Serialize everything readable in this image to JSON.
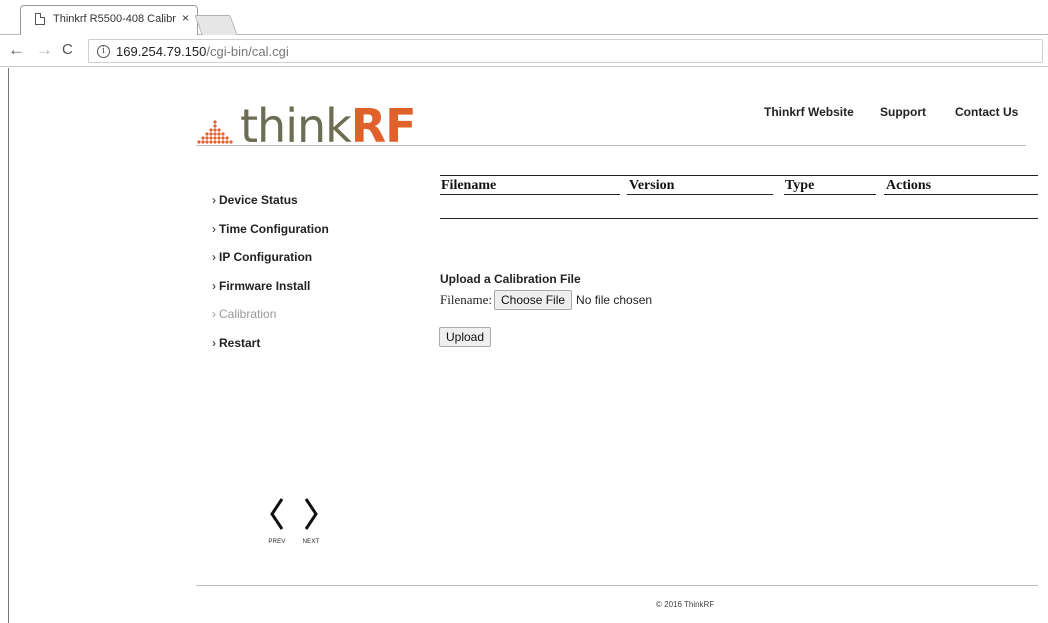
{
  "browser": {
    "tab_title": "Thinkrf R5500-408 Calibr",
    "tab_close": "×",
    "url_host": "169.254.79.150",
    "url_path": "/cgi-bin/cal.cgi",
    "info_glyph": "i",
    "back_glyph": "←",
    "forward_glyph": "→",
    "reload_glyph": "C"
  },
  "logo": {
    "think": "think",
    "rf": "RF"
  },
  "topnav": {
    "website": "Thinkrf Website",
    "support": "Support",
    "contact": "Contact Us"
  },
  "sidebar": {
    "chevron": "›",
    "items": [
      {
        "label": "Device Status"
      },
      {
        "label": "Time Configuration"
      },
      {
        "label": "IP Configuration"
      },
      {
        "label": "Firmware Install"
      },
      {
        "label": "Calibration"
      },
      {
        "label": "Restart"
      }
    ]
  },
  "table": {
    "headers": [
      "Filename",
      "Version",
      "Type",
      "Actions"
    ],
    "rows": []
  },
  "upload": {
    "title": "Upload a Calibration File",
    "filename_label": "Filename:",
    "choose_button": "Choose File",
    "no_file": "No file chosen",
    "upload_button": "Upload"
  },
  "pager": {
    "prev": "PREV",
    "next": "NEXT"
  },
  "footer": {
    "copyright": "© 2016 ThinkRF"
  },
  "colors": {
    "logo_gray": "#6d6d54",
    "logo_orange": "#e0612a",
    "active_nav": "#999999"
  }
}
